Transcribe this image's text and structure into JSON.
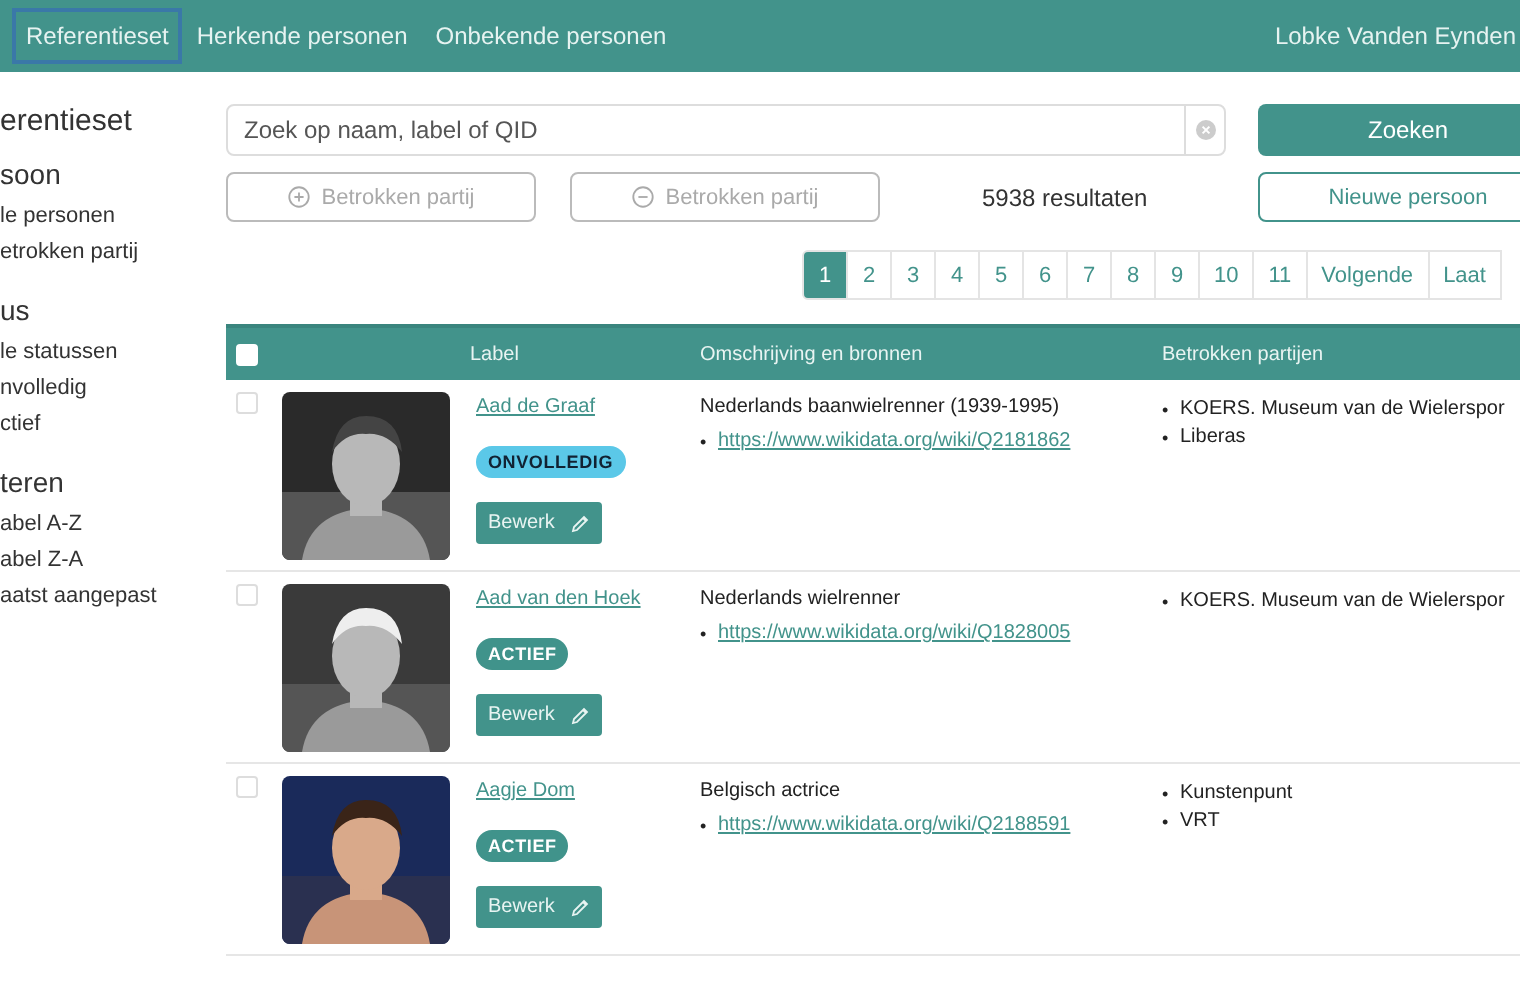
{
  "nav": {
    "items": [
      {
        "label": "Referentieset",
        "selected": true
      },
      {
        "label": "Herkende personen",
        "selected": false
      },
      {
        "label": "Onbekende personen",
        "selected": false
      }
    ],
    "user": "Lobke Vanden Eynden"
  },
  "sidebar": {
    "title": "erentieset",
    "sections": [
      {
        "heading": "soon",
        "items": [
          "le personen",
          "etrokken partij"
        ]
      },
      {
        "heading": "us",
        "items": [
          "le statussen",
          "nvolledig",
          "ctief"
        ]
      },
      {
        "heading": "teren",
        "items": [
          "abel A-Z",
          "abel Z-A",
          "aatst aangepast"
        ]
      }
    ]
  },
  "search": {
    "placeholder": "Zoek op naam, label of QID",
    "button": "Zoeken"
  },
  "filters": [
    {
      "kind": "add",
      "label": "Betrokken partij"
    },
    {
      "kind": "remove",
      "label": "Betrokken partij"
    }
  ],
  "result_count": "5938 resultaten",
  "new_button": "Nieuwe persoon",
  "pagination": [
    {
      "label": "1",
      "selected": true
    },
    {
      "label": "2",
      "selected": false
    },
    {
      "label": "3",
      "selected": false
    },
    {
      "label": "4",
      "selected": false
    },
    {
      "label": "5",
      "selected": false
    },
    {
      "label": "6",
      "selected": false
    },
    {
      "label": "7",
      "selected": false
    },
    {
      "label": "8",
      "selected": false
    },
    {
      "label": "9",
      "selected": false
    },
    {
      "label": "10",
      "selected": false
    },
    {
      "label": "11",
      "selected": false
    },
    {
      "label": "Volgende",
      "selected": false
    },
    {
      "label": "Laat",
      "selected": false
    }
  ],
  "table": {
    "bullet": "•",
    "select_all": {
      "checked": false
    },
    "columns": [
      "Label",
      "Omschrijving en bronnen",
      "Betrokken partijen"
    ],
    "rows": [
      {
        "checked": false,
        "photo": {
          "kind": "picture"
        },
        "label": "Aad de Graaf",
        "status": {
          "text": "ONVOLLEDIG",
          "color": "#5bc8e8"
        },
        "edit": "Bewerk",
        "description": "Nederlands baanwielrenner (1939-1995)",
        "link": "https://www.wikidata.org/wiki/Q2181862",
        "parties": [
          "KOERS. Museum van de Wielerspor",
          "Liberas"
        ]
      },
      {
        "checked": false,
        "photo": {
          "kind": "picture"
        },
        "label": "Aad van den Hoek",
        "status": {
          "text": "ACTIEF",
          "color": "#40938b"
        },
        "edit": "Bewerk",
        "description": "Nederlands wielrenner",
        "link": "https://www.wikidata.org/wiki/Q1828005",
        "parties": [
          "KOERS. Museum van de Wielerspor"
        ]
      },
      {
        "checked": false,
        "photo": {
          "kind": "picture"
        },
        "label": "Aagje Dom",
        "status": {
          "text": "ACTIEF",
          "color": "#40938b"
        },
        "edit": "Bewerk",
        "description": "Belgisch actrice",
        "link": "https://www.wikidata.org/wiki/Q2188591",
        "parties": [
          "Kunstenpunt",
          "VRT"
        ]
      }
    ]
  }
}
